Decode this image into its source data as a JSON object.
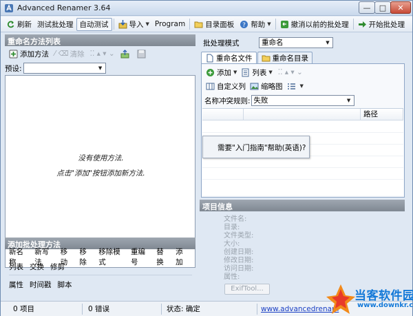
{
  "window": {
    "title": "Advanced Renamer 3.64",
    "minimize": "—",
    "maximize": "□",
    "close": "✕"
  },
  "toolbar": {
    "refresh": "刷新",
    "test_batch": "测试批处理",
    "auto_test": "自动测试",
    "import": "导入",
    "program": "Program",
    "dir_panel": "目录面板",
    "help": "帮助",
    "undo_batch": "撤消以前的批处理",
    "start_batch": "开始批处理"
  },
  "left": {
    "header": "重命名方法列表",
    "add_method": "添加方法",
    "clear": "清除",
    "preset_label": "预设:",
    "preset_value": "",
    "empty_line1": "没有使用方法.",
    "empty_line2": "点击\"添加\"按钮添加新方法."
  },
  "add_methods": {
    "header": "添加批处理方法",
    "rows": [
      [
        "新名称",
        "新写法",
        "移动",
        "移除",
        "移除模式",
        "重编号",
        "替换",
        "添加"
      ],
      [
        "列表",
        "交换",
        "修剪"
      ],
      [
        "属性",
        "时间戳",
        "脚本"
      ]
    ]
  },
  "right": {
    "batch_mode_label": "批处理模式",
    "batch_mode_value": "重命名",
    "tabs": [
      "重命名文件",
      "重命名目录"
    ],
    "add": "添加",
    "list": "列表",
    "custom_columns": "自定义列",
    "thumbnails": "缩略图",
    "conflict_label": "名称冲突规则:",
    "conflict_value": "失败",
    "columns": [
      "",
      "",
      "路径"
    ],
    "tooltip": "需要\"入门指南\"帮助(英语)?",
    "info_header": "项目信息",
    "info_fields": [
      "文件名:",
      "目录:",
      "文件类型:",
      "大小:",
      "创建日期:",
      "修改日期:",
      "访问日期:",
      "属性:"
    ],
    "exif_button": "ExifTool..."
  },
  "status": {
    "items": "0 项目",
    "errors": "0 错误",
    "state": "状态: 确定",
    "link": "www.advancedrenam"
  },
  "watermark": {
    "text": "当客软件园",
    "sub": "www.downkr.com"
  },
  "colors": {
    "accent": "#1479d8",
    "header_bg": "#8f98a2",
    "window_bg": "#dfe8f3"
  }
}
